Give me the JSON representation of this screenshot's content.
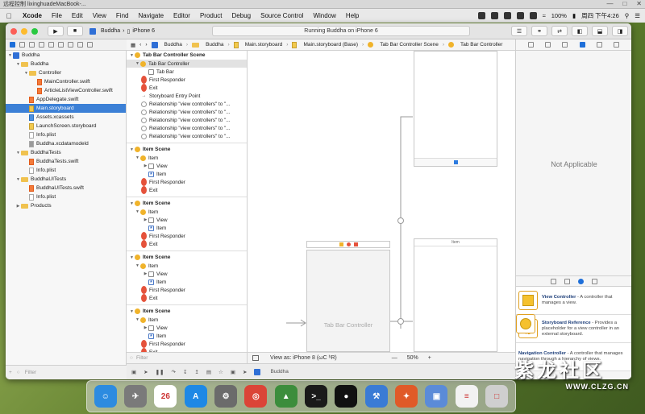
{
  "remote": {
    "title": "远程控制  lixinghuadeMacBook-..."
  },
  "menubar": {
    "app": "Xcode",
    "items": [
      "File",
      "Edit",
      "View",
      "Find",
      "Navigate",
      "Editor",
      "Product",
      "Debug",
      "Source Control",
      "Window",
      "Help"
    ],
    "battery": "100%",
    "clock": "周四 下午4:26"
  },
  "toolbar": {
    "scheme": "Buddha",
    "device": "iPhone 6",
    "status": "Running Buddha on iPhone 6"
  },
  "navigator": {
    "tree": [
      {
        "label": "Buddha",
        "indent": 0,
        "type": "proj",
        "open": true
      },
      {
        "label": "Buddha",
        "indent": 1,
        "type": "folder",
        "open": true
      },
      {
        "label": "Controller",
        "indent": 2,
        "type": "folder",
        "open": true
      },
      {
        "label": "MainController.swift",
        "indent": 3,
        "type": "swift"
      },
      {
        "label": "ArticleListViewController.swift",
        "indent": 3,
        "type": "swift"
      },
      {
        "label": "AppDelegate.swift",
        "indent": 2,
        "type": "swift"
      },
      {
        "label": "Main.storyboard",
        "indent": 2,
        "type": "sb",
        "selected": true
      },
      {
        "label": "Assets.xcassets",
        "indent": 2,
        "type": "xc"
      },
      {
        "label": "LaunchScreen.storyboard",
        "indent": 2,
        "type": "sb"
      },
      {
        "label": "Info.plist",
        "indent": 2,
        "type": "file"
      },
      {
        "label": "Buddha.xcdatamodeld",
        "indent": 2,
        "type": "dm"
      },
      {
        "label": "BuddhaTests",
        "indent": 1,
        "type": "folder",
        "open": true
      },
      {
        "label": "BuddhaTests.swift",
        "indent": 2,
        "type": "swift"
      },
      {
        "label": "Info.plist",
        "indent": 2,
        "type": "file"
      },
      {
        "label": "BuddhaUITests",
        "indent": 1,
        "type": "folder",
        "open": true
      },
      {
        "label": "BuddhaUITests.swift",
        "indent": 2,
        "type": "swift"
      },
      {
        "label": "Info.plist",
        "indent": 2,
        "type": "file"
      },
      {
        "label": "Products",
        "indent": 1,
        "type": "folder",
        "open": false
      }
    ],
    "filter_placeholder": "Filter"
  },
  "jumpbar": [
    "Buddha",
    "Buddha",
    "Main.storyboard",
    "Main.storyboard (Base)",
    "Tab Bar Controller Scene",
    "Tab Bar Controller"
  ],
  "outline": {
    "tab_scene": {
      "title": "Tab Bar Controller Scene",
      "controller": "Tab Bar Controller",
      "tabbar": "Tab Bar",
      "first_responder": "First Responder",
      "exit": "Exit",
      "entry": "Storyboard Entry Point",
      "relationships": [
        "Relationship \"view controllers\" to \"...",
        "Relationship \"view controllers\" to \"...",
        "Relationship \"view controllers\" to \"...",
        "Relationship \"view controllers\" to \"...",
        "Relationship \"view controllers\" to \"..."
      ]
    },
    "item_scenes": [
      {
        "title": "Item Scene",
        "item": "Item",
        "view": "View",
        "item2": "Item",
        "fr": "First Responder",
        "exit": "Exit"
      },
      {
        "title": "Item Scene",
        "item": "Item",
        "view": "View",
        "item2": "Item",
        "fr": "First Responder",
        "exit": "Exit"
      },
      {
        "title": "Item Scene",
        "item": "Item",
        "view": "View",
        "item2": "Item",
        "fr": "First Responder",
        "exit": "Exit"
      },
      {
        "title": "Item Scene",
        "item": "Item",
        "view": "View",
        "item2": "Item",
        "fr": "First Responder",
        "exit": "Exit"
      }
    ],
    "filter_placeholder": "Filter"
  },
  "canvas": {
    "tab_bar_controller_label": "Tab Bar Controller",
    "small_item_label": "Item",
    "view_as": "View as: iPhone 8 (ωC ʰR)",
    "minus": "—",
    "zoom": "50%",
    "plus": "+"
  },
  "bottom": {
    "scheme_label": "Buddha"
  },
  "inspector": {
    "not_applicable": "Not Applicable",
    "library": [
      {
        "title": "View Controller",
        "desc": " - A controller that manages a view.",
        "icon": "view-controller-icon"
      },
      {
        "title": "Storyboard Reference",
        "desc": " - Provides a placeholder for a view controller in an external storyboard.",
        "icon": "storyboard-reference-icon"
      },
      {
        "title": "Navigation Controller",
        "desc": " - A controller that manages navigation through a hierarchy of views.",
        "icon": "navigation-controller-icon"
      }
    ]
  },
  "dock": {
    "apps": [
      {
        "name": "finder-icon",
        "color": "#2d8be0",
        "glyph": "☺"
      },
      {
        "name": "launchpad-icon",
        "color": "#7a7a7a",
        "glyph": "✈"
      },
      {
        "name": "calendar-icon",
        "color": "#ffffff",
        "glyph": "26"
      },
      {
        "name": "app-store-icon",
        "color": "#1e88e5",
        "glyph": "A"
      },
      {
        "name": "system-preferences-icon",
        "color": "#6b6b6b",
        "glyph": "⚙"
      },
      {
        "name": "chrome-icon",
        "color": "#db4437",
        "glyph": "◎"
      },
      {
        "name": "android-studio-icon",
        "color": "#3c8d3c",
        "glyph": "▲"
      },
      {
        "name": "terminal-icon",
        "color": "#1a1a1a",
        "glyph": ">_"
      },
      {
        "name": "qq-icon",
        "color": "#111111",
        "glyph": "●"
      },
      {
        "name": "xcode-icon",
        "color": "#3a7bd5",
        "glyph": "⚒"
      },
      {
        "name": "photo-booth-icon",
        "color": "#e05a28",
        "glyph": "✦"
      },
      {
        "name": "preview-icon",
        "color": "#5b8bd8",
        "glyph": "▣"
      },
      {
        "name": "document-icon",
        "color": "#f2f2f2",
        "glyph": "≡"
      },
      {
        "name": "trash-icon",
        "color": "#cfcfcf",
        "glyph": "□"
      }
    ]
  },
  "watermark": {
    "text": "紫龙社区",
    "sub": "WWW.CLZG.CN"
  },
  "colors": {
    "accent": "#3c80d6",
    "folder": "#f0c24f",
    "swift": "#f37a3a"
  }
}
